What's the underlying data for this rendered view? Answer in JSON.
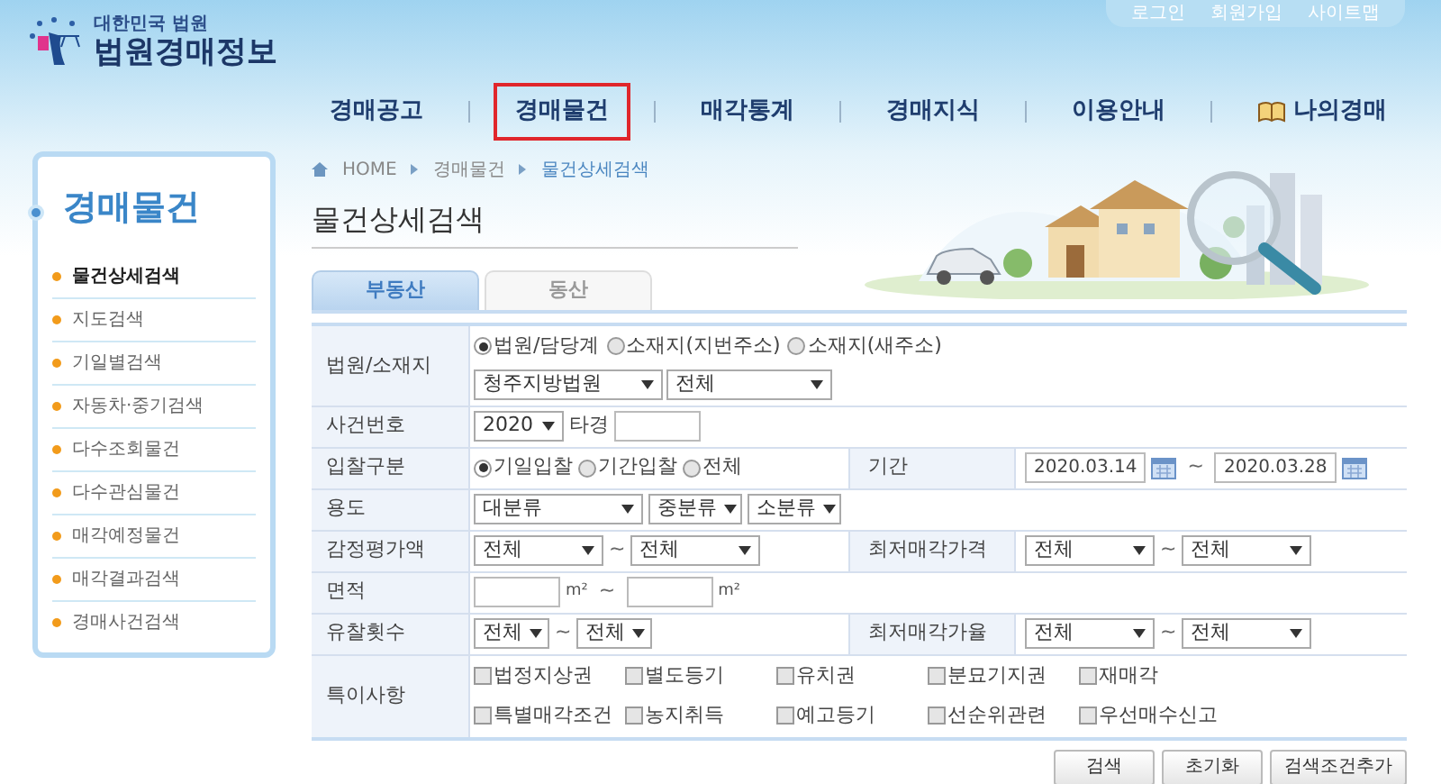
{
  "logo": {
    "small": "대한민국 법원",
    "main": "법원경매정보"
  },
  "util_links": [
    "로그인",
    "회원가입",
    "사이트맵"
  ],
  "nav": [
    {
      "label": "경매공고",
      "selected": false,
      "kind": "text"
    },
    {
      "label": "경매물건",
      "selected": true,
      "kind": "text"
    },
    {
      "label": "매각통계",
      "selected": false,
      "kind": "text"
    },
    {
      "label": "경매지식",
      "selected": false,
      "kind": "text"
    },
    {
      "label": "이용안내",
      "selected": false,
      "kind": "text"
    },
    {
      "label": "나의경매",
      "selected": false,
      "kind": "book"
    }
  ],
  "sidebar": {
    "title": "경매물건",
    "items": [
      {
        "label": "물건상세검색",
        "selected": true
      },
      {
        "label": "지도검색",
        "selected": false
      },
      {
        "label": "기일별검색",
        "selected": false
      },
      {
        "label": "자동차·중기검색",
        "selected": false
      },
      {
        "label": "다수조회물건",
        "selected": false
      },
      {
        "label": "다수관심물건",
        "selected": false
      },
      {
        "label": "매각예정물건",
        "selected": false
      },
      {
        "label": "매각결과검색",
        "selected": false
      },
      {
        "label": "경매사건검색",
        "selected": false
      }
    ]
  },
  "breadcrumb": [
    "HOME",
    "경매물건",
    "물건상세검색"
  ],
  "page_title": "물건상세검색",
  "tabs": [
    {
      "label": "부동산",
      "selected": true
    },
    {
      "label": "동산",
      "selected": false
    }
  ],
  "form_rows": [
    {
      "kind": "radio_selects",
      "label": "법원/소재지",
      "options": [
        {
          "label": "법원/담당계",
          "selected": true
        },
        {
          "label": "소재지(지번주소)",
          "selected": false
        },
        {
          "label": "소재지(새주소)",
          "selected": false
        }
      ],
      "selects": [
        "청주지방법원",
        "전체"
      ]
    },
    {
      "kind": "case_no",
      "label": "사건번호",
      "select": "2020",
      "text": "타경"
    },
    {
      "kind": "radio_period",
      "label": "입찰구분",
      "options": [
        {
          "label": "기일입찰",
          "selected": true
        },
        {
          "label": "기간입찰",
          "selected": false
        },
        {
          "label": "전체",
          "selected": false
        }
      ],
      "period_label": "기간",
      "from": "2020.03.14",
      "separator": "~",
      "to": "2020.03.28"
    },
    {
      "kind": "selects",
      "label": "용도",
      "selects": [
        "대분류",
        "중분류",
        "소분류"
      ]
    },
    {
      "kind": "range_pair",
      "label": "감정평가액",
      "from": "전체",
      "separator": "~",
      "to": "전체",
      "label2": "최저매각가격",
      "from2": "전체",
      "separator2": "~",
      "to2": "전체"
    },
    {
      "kind": "area",
      "label": "면적",
      "unit": "m²",
      "separator": "~",
      "unit2": "m²"
    },
    {
      "kind": "range_pair",
      "label": "유찰횟수",
      "from": "전체",
      "separator": "~",
      "to": "전체",
      "label2": "최저매각가율",
      "from2": "전체",
      "separator2": "~",
      "to2": "전체"
    },
    {
      "kind": "checks",
      "label": "특이사항",
      "options": [
        {
          "label": "법정지상권",
          "checked": false
        },
        {
          "label": "별도등기",
          "checked": false
        },
        {
          "label": "유치권",
          "checked": false
        },
        {
          "label": "분묘기지권",
          "checked": false
        },
        {
          "label": "재매각",
          "checked": false
        },
        {
          "label": "특별매각조건",
          "checked": false
        },
        {
          "label": "농지취득",
          "checked": false
        },
        {
          "label": "예고등기",
          "checked": false
        },
        {
          "label": "선순위관련",
          "checked": false
        },
        {
          "label": "우선매수신고",
          "checked": false
        }
      ]
    }
  ],
  "buttons": [
    "검색",
    "초기화",
    "검색조건추가"
  ]
}
